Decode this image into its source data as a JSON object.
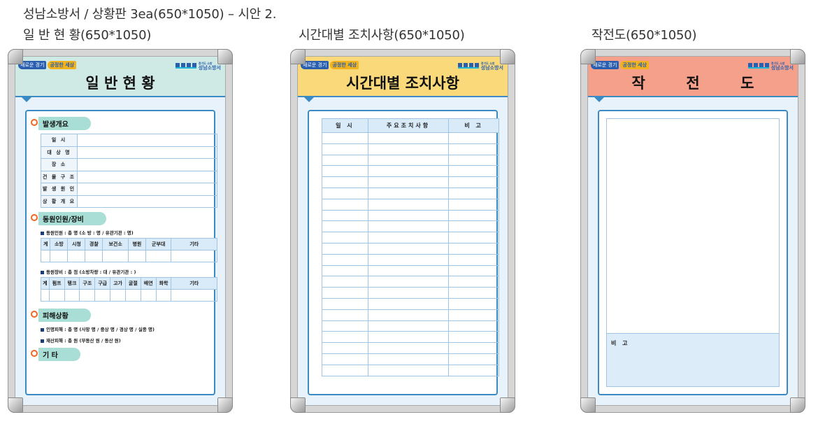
{
  "page_title": "성남소방서 / 상황판 3ea(650*1050) – 시안 2.",
  "boards": [
    {
      "label": "일 반 현 황(650*1050)",
      "title": "일 반 현 황",
      "header_color": "#cfe9e4",
      "slogan": [
        "새로운 경기",
        "공정한 세상"
      ],
      "logo_sub": "경기도 소방",
      "logo_text": "성남소방서",
      "sections": {
        "overview": "발생개요",
        "mobilization": "동원인원/장비",
        "damage": "피해상황",
        "other": "기      타"
      },
      "overview_rows": [
        "일        시",
        "대  상  명",
        "장        소",
        "건 물 구 조",
        "발 생 원 인",
        "상 황 개 요"
      ],
      "personnel_line": "동원인원 : 총              명 (소      방 :                  명 / 유관기관 :               명)",
      "personnel_cols": [
        "계",
        "소방",
        "시청",
        "경찰",
        "보건소",
        "병원",
        "군부대",
        "기타"
      ],
      "equipment_line": "동원장비 : 총              점 (소방차량 :                   대 / 유관기관 :                 )",
      "equipment_cols": [
        "계",
        "펌프",
        "탱크",
        "구조",
        "구급",
        "고가",
        "굴절",
        "배연",
        "화학",
        "기타"
      ],
      "casualty_line": "인명피해 : 총          명 (사망       명 / 중상       명 / 경상       명 / 실종        명)",
      "property_line": "재산피해 : 총          원 (부동산                        원 / 동산                            원)"
    },
    {
      "label": "시간대별 조치사항(650*1050)",
      "title": "시간대별 조치사항",
      "header_color": "#f9d97a",
      "slogan": [
        "새로운 경기",
        "공정한 세상"
      ],
      "logo_sub": "경기도 소방",
      "logo_text": "성남소방서",
      "columns": [
        "일  시",
        "주요조치사항",
        "비  고"
      ],
      "row_count": 22
    },
    {
      "label": "작전도(650*1050)",
      "title": "작        전        도",
      "header_color": "#f4a08a",
      "slogan": [
        "새로운 경기",
        "공정한 세상"
      ],
      "logo_sub": "경기도 소방",
      "logo_text": "성남소방서",
      "note_label": "비  고"
    }
  ]
}
